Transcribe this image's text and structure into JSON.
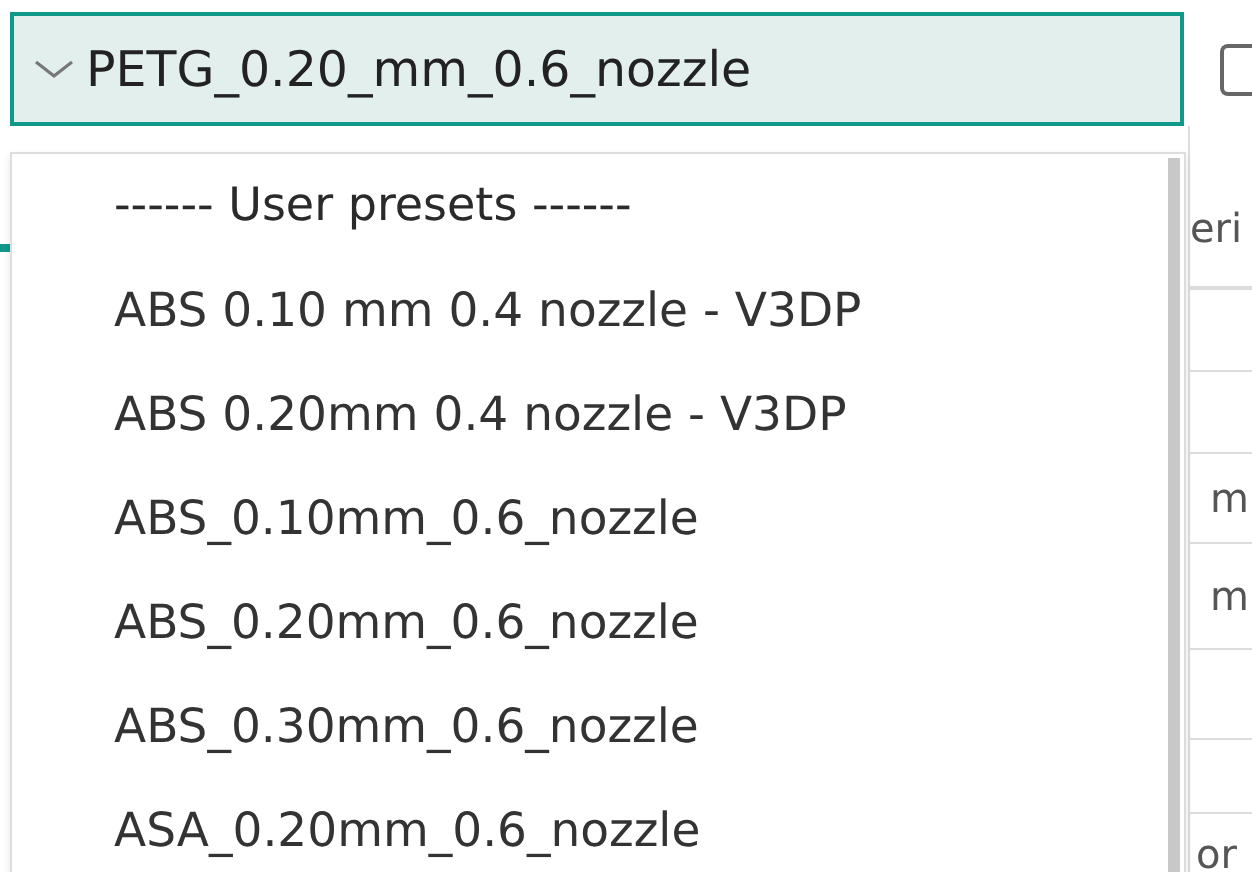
{
  "preset_select": {
    "value": "PETG_0.20_mm_0.6_nozzle",
    "expanded": true
  },
  "dropdown_items": [
    {
      "kind": "header",
      "label": "------ User presets ------"
    },
    {
      "kind": "option",
      "label": "ABS 0.10 mm 0.4 nozzle - V3DP"
    },
    {
      "kind": "option",
      "label": "ABS 0.20mm 0.4 nozzle - V3DP"
    },
    {
      "kind": "option",
      "label": "ABS_0.10mm_0.6_nozzle"
    },
    {
      "kind": "option",
      "label": "ABS_0.20mm_0.6_nozzle"
    },
    {
      "kind": "option",
      "label": "ABS_0.30mm_0.6_nozzle"
    },
    {
      "kind": "option",
      "label": "ASA_0.20mm_0.6_nozzle"
    }
  ],
  "background_texts": [
    "eri",
    "m",
    "m",
    "or"
  ]
}
